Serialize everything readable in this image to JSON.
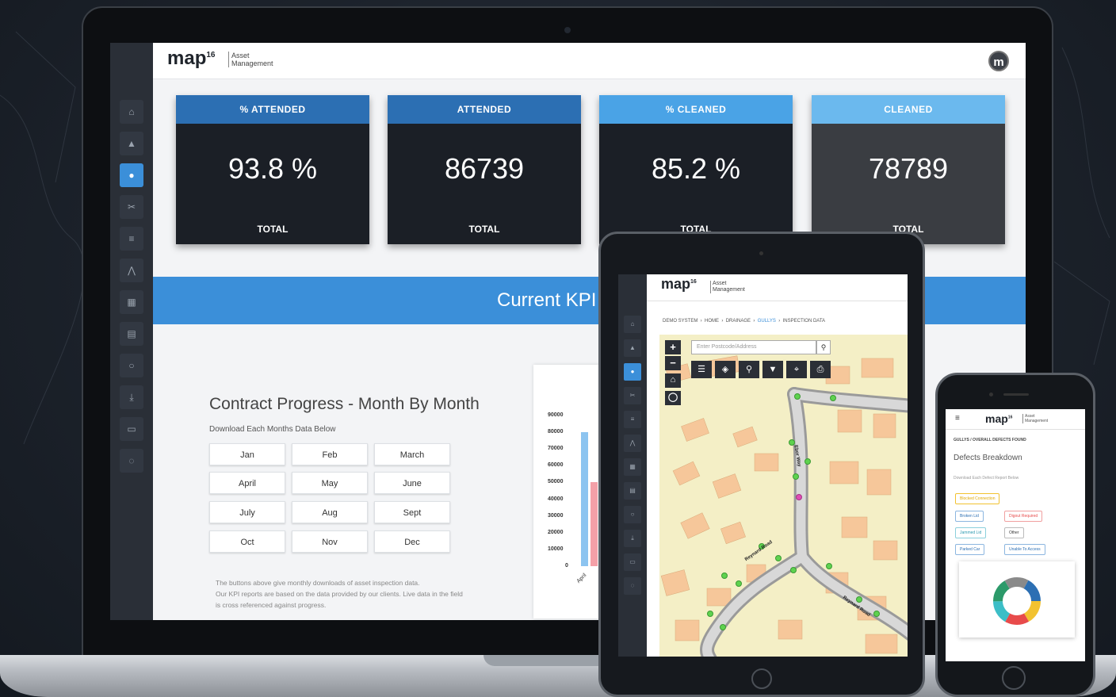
{
  "app": {
    "logo": "map",
    "logo_sup": "16",
    "logo_sub": "Asset Management",
    "avatar": "m"
  },
  "sidebar": {
    "items": [
      {
        "icon": "home-icon",
        "glyph": "⌂"
      },
      {
        "icon": "bell-icon",
        "glyph": "▲"
      },
      {
        "icon": "drop-icon",
        "glyph": "●",
        "active": true
      },
      {
        "icon": "scissors-icon",
        "glyph": "✂"
      },
      {
        "icon": "list-icon",
        "glyph": "≡"
      },
      {
        "icon": "road-icon",
        "glyph": "⋀"
      },
      {
        "icon": "calendar-icon",
        "glyph": "▦"
      },
      {
        "icon": "document-icon",
        "glyph": "▤"
      },
      {
        "icon": "circle-icon",
        "glyph": "○"
      },
      {
        "icon": "download-icon",
        "glyph": "⤓"
      },
      {
        "icon": "card-icon",
        "glyph": "▭"
      },
      {
        "icon": "chat-icon",
        "glyph": "◌"
      }
    ]
  },
  "kpis": [
    {
      "label": "% ATTENDED",
      "value": "93.8 %",
      "foot": "TOTAL",
      "color": "#2c6fb3"
    },
    {
      "label": "ATTENDED",
      "value": "86739",
      "foot": "TOTAL",
      "color": "#2c6fb3"
    },
    {
      "label": "% CLEANED",
      "value": "85.2 %",
      "foot": "TOTAL",
      "color": "#4aa3e6"
    },
    {
      "label": "CLEANED",
      "value": "78789",
      "foot": "TOTAL",
      "color": "#6bb9ee"
    }
  ],
  "kpi_banner": "Current KPI",
  "contract": {
    "title": "Contract Progress - Month By Month",
    "subtitle": "Download Each Months Data Below",
    "months": [
      "Jan",
      "Feb",
      "March",
      "April",
      "May",
      "June",
      "July",
      "Aug",
      "Sept",
      "Oct",
      "Nov",
      "Dec"
    ],
    "note_lines": [
      "The buttons above give monthly downloads of asset inspection data.",
      "Our KPI reports are based on the data provided by our clients. Live data in the field",
      "is cross referenced against progress."
    ]
  },
  "chart_data": {
    "type": "bar",
    "categories": [
      "April"
    ],
    "series": [
      {
        "values": [
          80000
        ],
        "color": "#8cc4f0"
      },
      {
        "values": [
          50000
        ],
        "color": "#f4a0a8"
      }
    ],
    "ylim": [
      0,
      90000
    ],
    "yticks": [
      "90000",
      "80000",
      "70000",
      "60000",
      "50000",
      "40000",
      "30000",
      "20000",
      "10000",
      "0"
    ]
  },
  "tablet": {
    "logo": "map",
    "logo_sup": "16",
    "logo_sub": "Asset Management",
    "breadcrumb": [
      "DEMO SYSTEM",
      "HOME",
      "DRAINAGE",
      "GULLYS",
      "INSPECTION DATA"
    ],
    "search_placeholder": "Enter Postcode/Address",
    "road_labels": [
      "Ebor Way",
      "Reynard Road",
      "Reynard Road"
    ],
    "colors": {
      "map_bg": "#f4efc6",
      "building": "#f6c79a",
      "road": "#9a9a9a",
      "marker": "#5fd24f"
    }
  },
  "phone": {
    "logo": "map",
    "logo_sup": "16",
    "logo_sub": "Asset Management",
    "breadcrumb": "GULLYS / OVERALL DEFECTS FOUND",
    "title": "Defects Breakdown",
    "subtitle": "Download Each Defect Report Below",
    "chips": [
      "Blocked Connection",
      "Broken Lid",
      "Digout Required",
      "Jammed Lid",
      "Other",
      "Parked Car",
      "Unable To Access"
    ],
    "donut_colors": [
      "#f2c230",
      "#e84b4b",
      "#3cbec7",
      "#2c6fb3",
      "#8a8a8a",
      "#2c9a6a"
    ]
  }
}
